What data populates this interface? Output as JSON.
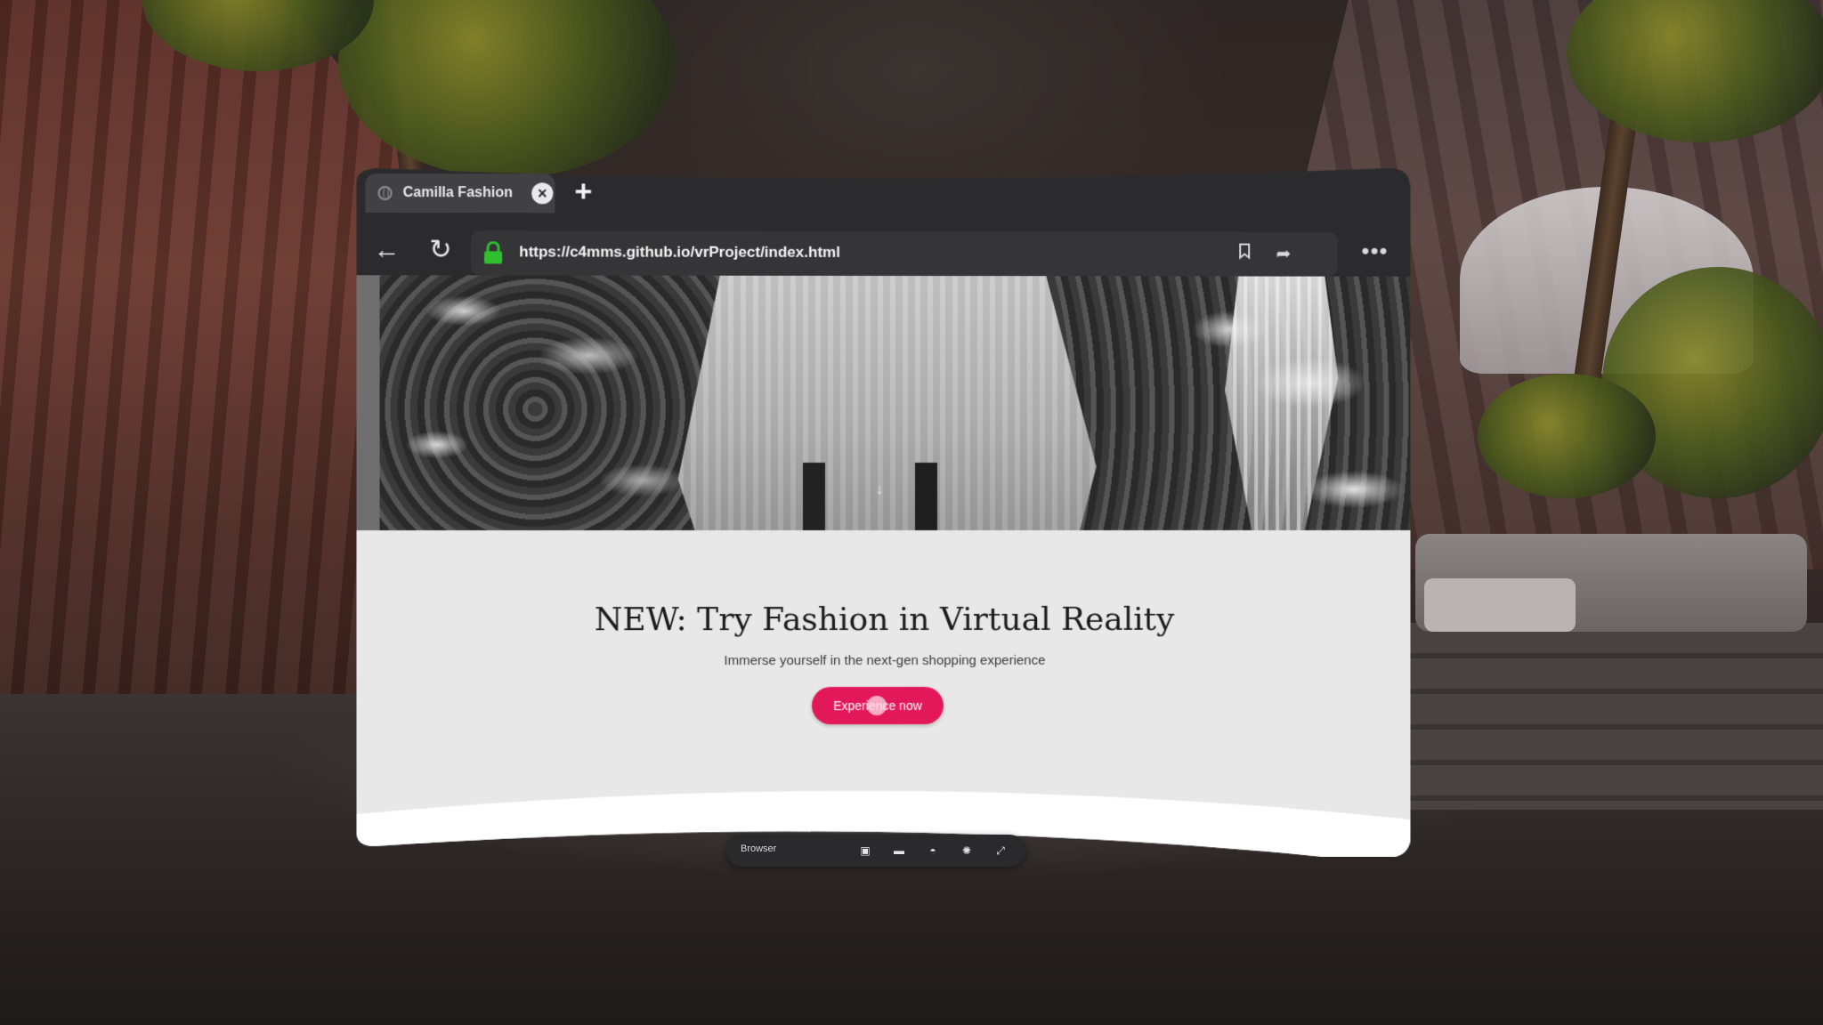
{
  "browser": {
    "tab": {
      "title": "Camilla Fashion",
      "favicon": "globe-icon",
      "close_icon": "close-icon"
    },
    "new_tab_icon": "plus-icon",
    "nav": {
      "back_icon": "back-arrow-icon",
      "reload_icon": "reload-icon"
    },
    "address_bar": {
      "url": "https://c4mms.github.io/vrProject/index.html",
      "secure_icon": "lock-icon",
      "secure_color": "#2fbf2f",
      "bookmark_icon": "bookmark-icon",
      "share_icon": "share-icon"
    },
    "more_icon": "more-dots-icon"
  },
  "page": {
    "hero_image": "black-and-white fashion photo",
    "scroll_indicator": "↓",
    "headline": "NEW: Try Fashion in Virtual Reality",
    "subheadline": "Immerse yourself in the next-gen shopping experience",
    "cta_label": "Experience now",
    "cta_color": "#e3185a"
  },
  "dock": {
    "label": "Browser",
    "icons": [
      "monitor-icon",
      "window-icon",
      "headset-icon",
      "brightness-icon",
      "fullscreen-icon"
    ]
  }
}
